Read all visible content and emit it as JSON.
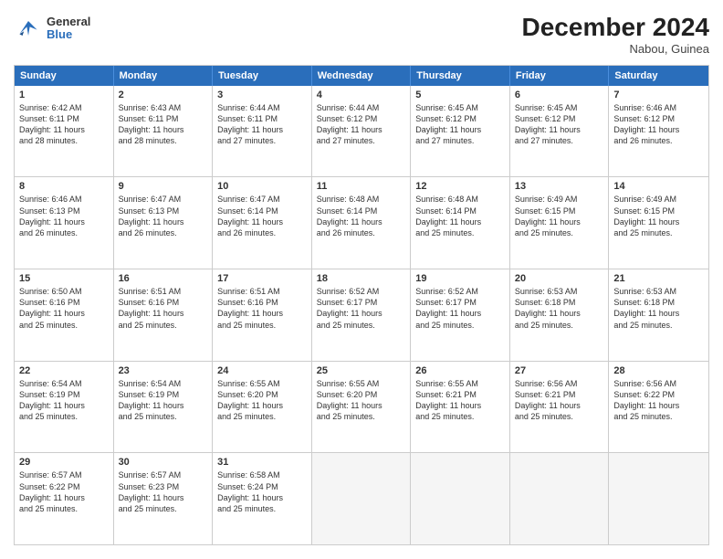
{
  "header": {
    "logo": {
      "general": "General",
      "blue": "Blue"
    },
    "title": "December 2024",
    "subtitle": "Nabou, Guinea"
  },
  "weekdays": [
    "Sunday",
    "Monday",
    "Tuesday",
    "Wednesday",
    "Thursday",
    "Friday",
    "Saturday"
  ],
  "rows": [
    [
      {
        "day": "1",
        "lines": [
          "Sunrise: 6:42 AM",
          "Sunset: 6:11 PM",
          "Daylight: 11 hours",
          "and 28 minutes."
        ]
      },
      {
        "day": "2",
        "lines": [
          "Sunrise: 6:43 AM",
          "Sunset: 6:11 PM",
          "Daylight: 11 hours",
          "and 28 minutes."
        ]
      },
      {
        "day": "3",
        "lines": [
          "Sunrise: 6:44 AM",
          "Sunset: 6:11 PM",
          "Daylight: 11 hours",
          "and 27 minutes."
        ]
      },
      {
        "day": "4",
        "lines": [
          "Sunrise: 6:44 AM",
          "Sunset: 6:12 PM",
          "Daylight: 11 hours",
          "and 27 minutes."
        ]
      },
      {
        "day": "5",
        "lines": [
          "Sunrise: 6:45 AM",
          "Sunset: 6:12 PM",
          "Daylight: 11 hours",
          "and 27 minutes."
        ]
      },
      {
        "day": "6",
        "lines": [
          "Sunrise: 6:45 AM",
          "Sunset: 6:12 PM",
          "Daylight: 11 hours",
          "and 27 minutes."
        ]
      },
      {
        "day": "7",
        "lines": [
          "Sunrise: 6:46 AM",
          "Sunset: 6:12 PM",
          "Daylight: 11 hours",
          "and 26 minutes."
        ]
      }
    ],
    [
      {
        "day": "8",
        "lines": [
          "Sunrise: 6:46 AM",
          "Sunset: 6:13 PM",
          "Daylight: 11 hours",
          "and 26 minutes."
        ]
      },
      {
        "day": "9",
        "lines": [
          "Sunrise: 6:47 AM",
          "Sunset: 6:13 PM",
          "Daylight: 11 hours",
          "and 26 minutes."
        ]
      },
      {
        "day": "10",
        "lines": [
          "Sunrise: 6:47 AM",
          "Sunset: 6:14 PM",
          "Daylight: 11 hours",
          "and 26 minutes."
        ]
      },
      {
        "day": "11",
        "lines": [
          "Sunrise: 6:48 AM",
          "Sunset: 6:14 PM",
          "Daylight: 11 hours",
          "and 26 minutes."
        ]
      },
      {
        "day": "12",
        "lines": [
          "Sunrise: 6:48 AM",
          "Sunset: 6:14 PM",
          "Daylight: 11 hours",
          "and 25 minutes."
        ]
      },
      {
        "day": "13",
        "lines": [
          "Sunrise: 6:49 AM",
          "Sunset: 6:15 PM",
          "Daylight: 11 hours",
          "and 25 minutes."
        ]
      },
      {
        "day": "14",
        "lines": [
          "Sunrise: 6:49 AM",
          "Sunset: 6:15 PM",
          "Daylight: 11 hours",
          "and 25 minutes."
        ]
      }
    ],
    [
      {
        "day": "15",
        "lines": [
          "Sunrise: 6:50 AM",
          "Sunset: 6:16 PM",
          "Daylight: 11 hours",
          "and 25 minutes."
        ]
      },
      {
        "day": "16",
        "lines": [
          "Sunrise: 6:51 AM",
          "Sunset: 6:16 PM",
          "Daylight: 11 hours",
          "and 25 minutes."
        ]
      },
      {
        "day": "17",
        "lines": [
          "Sunrise: 6:51 AM",
          "Sunset: 6:16 PM",
          "Daylight: 11 hours",
          "and 25 minutes."
        ]
      },
      {
        "day": "18",
        "lines": [
          "Sunrise: 6:52 AM",
          "Sunset: 6:17 PM",
          "Daylight: 11 hours",
          "and 25 minutes."
        ]
      },
      {
        "day": "19",
        "lines": [
          "Sunrise: 6:52 AM",
          "Sunset: 6:17 PM",
          "Daylight: 11 hours",
          "and 25 minutes."
        ]
      },
      {
        "day": "20",
        "lines": [
          "Sunrise: 6:53 AM",
          "Sunset: 6:18 PM",
          "Daylight: 11 hours",
          "and 25 minutes."
        ]
      },
      {
        "day": "21",
        "lines": [
          "Sunrise: 6:53 AM",
          "Sunset: 6:18 PM",
          "Daylight: 11 hours",
          "and 25 minutes."
        ]
      }
    ],
    [
      {
        "day": "22",
        "lines": [
          "Sunrise: 6:54 AM",
          "Sunset: 6:19 PM",
          "Daylight: 11 hours",
          "and 25 minutes."
        ]
      },
      {
        "day": "23",
        "lines": [
          "Sunrise: 6:54 AM",
          "Sunset: 6:19 PM",
          "Daylight: 11 hours",
          "and 25 minutes."
        ]
      },
      {
        "day": "24",
        "lines": [
          "Sunrise: 6:55 AM",
          "Sunset: 6:20 PM",
          "Daylight: 11 hours",
          "and 25 minutes."
        ]
      },
      {
        "day": "25",
        "lines": [
          "Sunrise: 6:55 AM",
          "Sunset: 6:20 PM",
          "Daylight: 11 hours",
          "and 25 minutes."
        ]
      },
      {
        "day": "26",
        "lines": [
          "Sunrise: 6:55 AM",
          "Sunset: 6:21 PM",
          "Daylight: 11 hours",
          "and 25 minutes."
        ]
      },
      {
        "day": "27",
        "lines": [
          "Sunrise: 6:56 AM",
          "Sunset: 6:21 PM",
          "Daylight: 11 hours",
          "and 25 minutes."
        ]
      },
      {
        "day": "28",
        "lines": [
          "Sunrise: 6:56 AM",
          "Sunset: 6:22 PM",
          "Daylight: 11 hours",
          "and 25 minutes."
        ]
      }
    ],
    [
      {
        "day": "29",
        "lines": [
          "Sunrise: 6:57 AM",
          "Sunset: 6:22 PM",
          "Daylight: 11 hours",
          "and 25 minutes."
        ]
      },
      {
        "day": "30",
        "lines": [
          "Sunrise: 6:57 AM",
          "Sunset: 6:23 PM",
          "Daylight: 11 hours",
          "and 25 minutes."
        ]
      },
      {
        "day": "31",
        "lines": [
          "Sunrise: 6:58 AM",
          "Sunset: 6:24 PM",
          "Daylight: 11 hours",
          "and 25 minutes."
        ]
      },
      null,
      null,
      null,
      null
    ]
  ]
}
